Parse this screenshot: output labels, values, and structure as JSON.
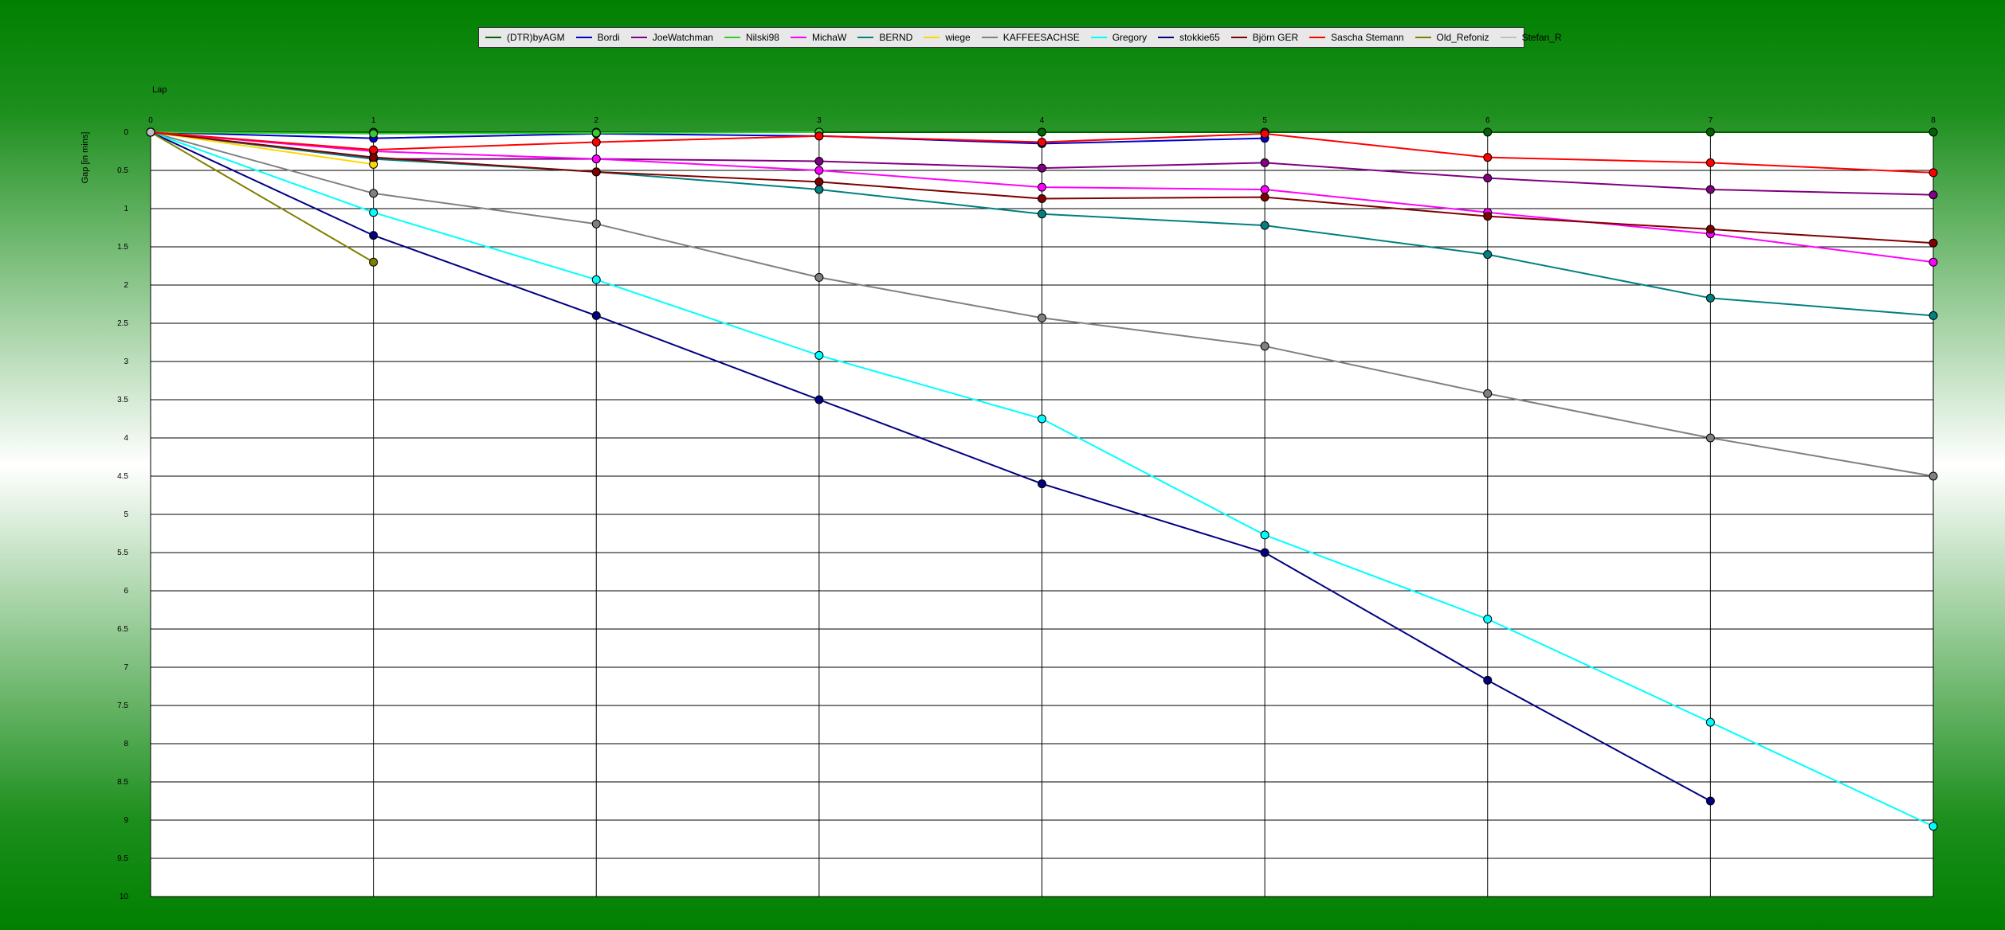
{
  "chart_data": {
    "type": "line",
    "xlabel": "Lap",
    "ylabel": "Gap [in mins]",
    "xlim": [
      0,
      8
    ],
    "ylim": [
      0,
      10
    ],
    "y_inverted": true,
    "grid": true,
    "legend_position": "top-center",
    "x_ticks": [
      "0",
      "1",
      "2",
      "3",
      "4",
      "5",
      "6",
      "7",
      "8"
    ],
    "y_ticks": [
      "0",
      "0.5",
      "1",
      "1.5",
      "2",
      "2.5",
      "3",
      "3.5",
      "4",
      "4.5",
      "5",
      "5.5",
      "6",
      "6.5",
      "7",
      "7.5",
      "8",
      "8.5",
      "9",
      "9.5",
      "10"
    ],
    "series": [
      {
        "name": "(DTR)byAGM",
        "color": "#006400",
        "x": [
          0,
          1,
          2,
          3,
          4,
          5,
          6,
          7,
          8
        ],
        "values": [
          0,
          0,
          0,
          0,
          0,
          0,
          0,
          0,
          0
        ]
      },
      {
        "name": "Bordi",
        "color": "#0000cd",
        "x": [
          0,
          1,
          2,
          3,
          4,
          5
        ],
        "values": [
          0,
          0.08,
          0.02,
          0.05,
          0.15,
          0.08
        ]
      },
      {
        "name": "JoeWatchman",
        "color": "#800080",
        "x": [
          0,
          1,
          2,
          3,
          4,
          5,
          6,
          7,
          8
        ],
        "values": [
          0,
          0.35,
          0.35,
          0.38,
          0.47,
          0.4,
          0.6,
          0.75,
          0.82
        ]
      },
      {
        "name": "Nilski98",
        "color": "#32cd32",
        "x": [
          0,
          1,
          2,
          3
        ],
        "values": [
          0,
          0.02,
          0.01,
          0
        ]
      },
      {
        "name": "MichaW",
        "color": "#ff00ff",
        "x": [
          0,
          1,
          2,
          3,
          4,
          5,
          6,
          7,
          8
        ],
        "values": [
          0,
          0.25,
          0.35,
          0.5,
          0.72,
          0.75,
          1.05,
          1.33,
          1.7
        ]
      },
      {
        "name": "BERND",
        "color": "#008080",
        "x": [
          0,
          1,
          2,
          3,
          4,
          5,
          6,
          7,
          8
        ],
        "values": [
          0,
          0.35,
          0.52,
          0.75,
          1.07,
          1.22,
          1.6,
          2.17,
          2.4
        ]
      },
      {
        "name": "wiege",
        "color": "#ffd700",
        "x": [
          0,
          1
        ],
        "values": [
          0,
          0.42
        ]
      },
      {
        "name": "KAFFEESACHSE",
        "color": "#808080",
        "x": [
          0,
          1,
          2,
          3,
          4,
          5,
          6,
          7,
          8
        ],
        "values": [
          0,
          0.8,
          1.2,
          1.9,
          2.43,
          2.8,
          3.42,
          4.0,
          4.5
        ]
      },
      {
        "name": "Gregory",
        "color": "#00ffff",
        "x": [
          0,
          1,
          2,
          3,
          4,
          5,
          6,
          7,
          8
        ],
        "values": [
          0,
          1.05,
          1.93,
          2.92,
          3.75,
          5.27,
          6.37,
          7.72,
          9.08
        ]
      },
      {
        "name": "stokkie65",
        "color": "#000080",
        "x": [
          0,
          1,
          2,
          3,
          4,
          5,
          6,
          7
        ],
        "values": [
          0,
          1.35,
          2.4,
          3.5,
          4.6,
          5.5,
          7.17,
          8.75
        ]
      },
      {
        "name": "Björn GER",
        "color": "#800000",
        "x": [
          0,
          1,
          2,
          3,
          4,
          5,
          6,
          7,
          8
        ],
        "values": [
          0,
          0.33,
          0.52,
          0.65,
          0.87,
          0.85,
          1.1,
          1.27,
          1.45
        ]
      },
      {
        "name": "Sascha Stemann",
        "color": "#ff0000",
        "x": [
          0,
          1,
          2,
          3,
          4,
          5,
          6,
          7,
          8
        ],
        "values": [
          0,
          0.23,
          0.13,
          0.05,
          0.13,
          0.02,
          0.33,
          0.4,
          0.53
        ]
      },
      {
        "name": "Old_Refoniz",
        "color": "#808000",
        "x": [
          0,
          1
        ],
        "values": [
          0,
          1.7
        ]
      },
      {
        "name": "Stefan_R",
        "color": "#c0c0c0",
        "x": [
          0
        ],
        "values": [
          0
        ]
      }
    ]
  }
}
